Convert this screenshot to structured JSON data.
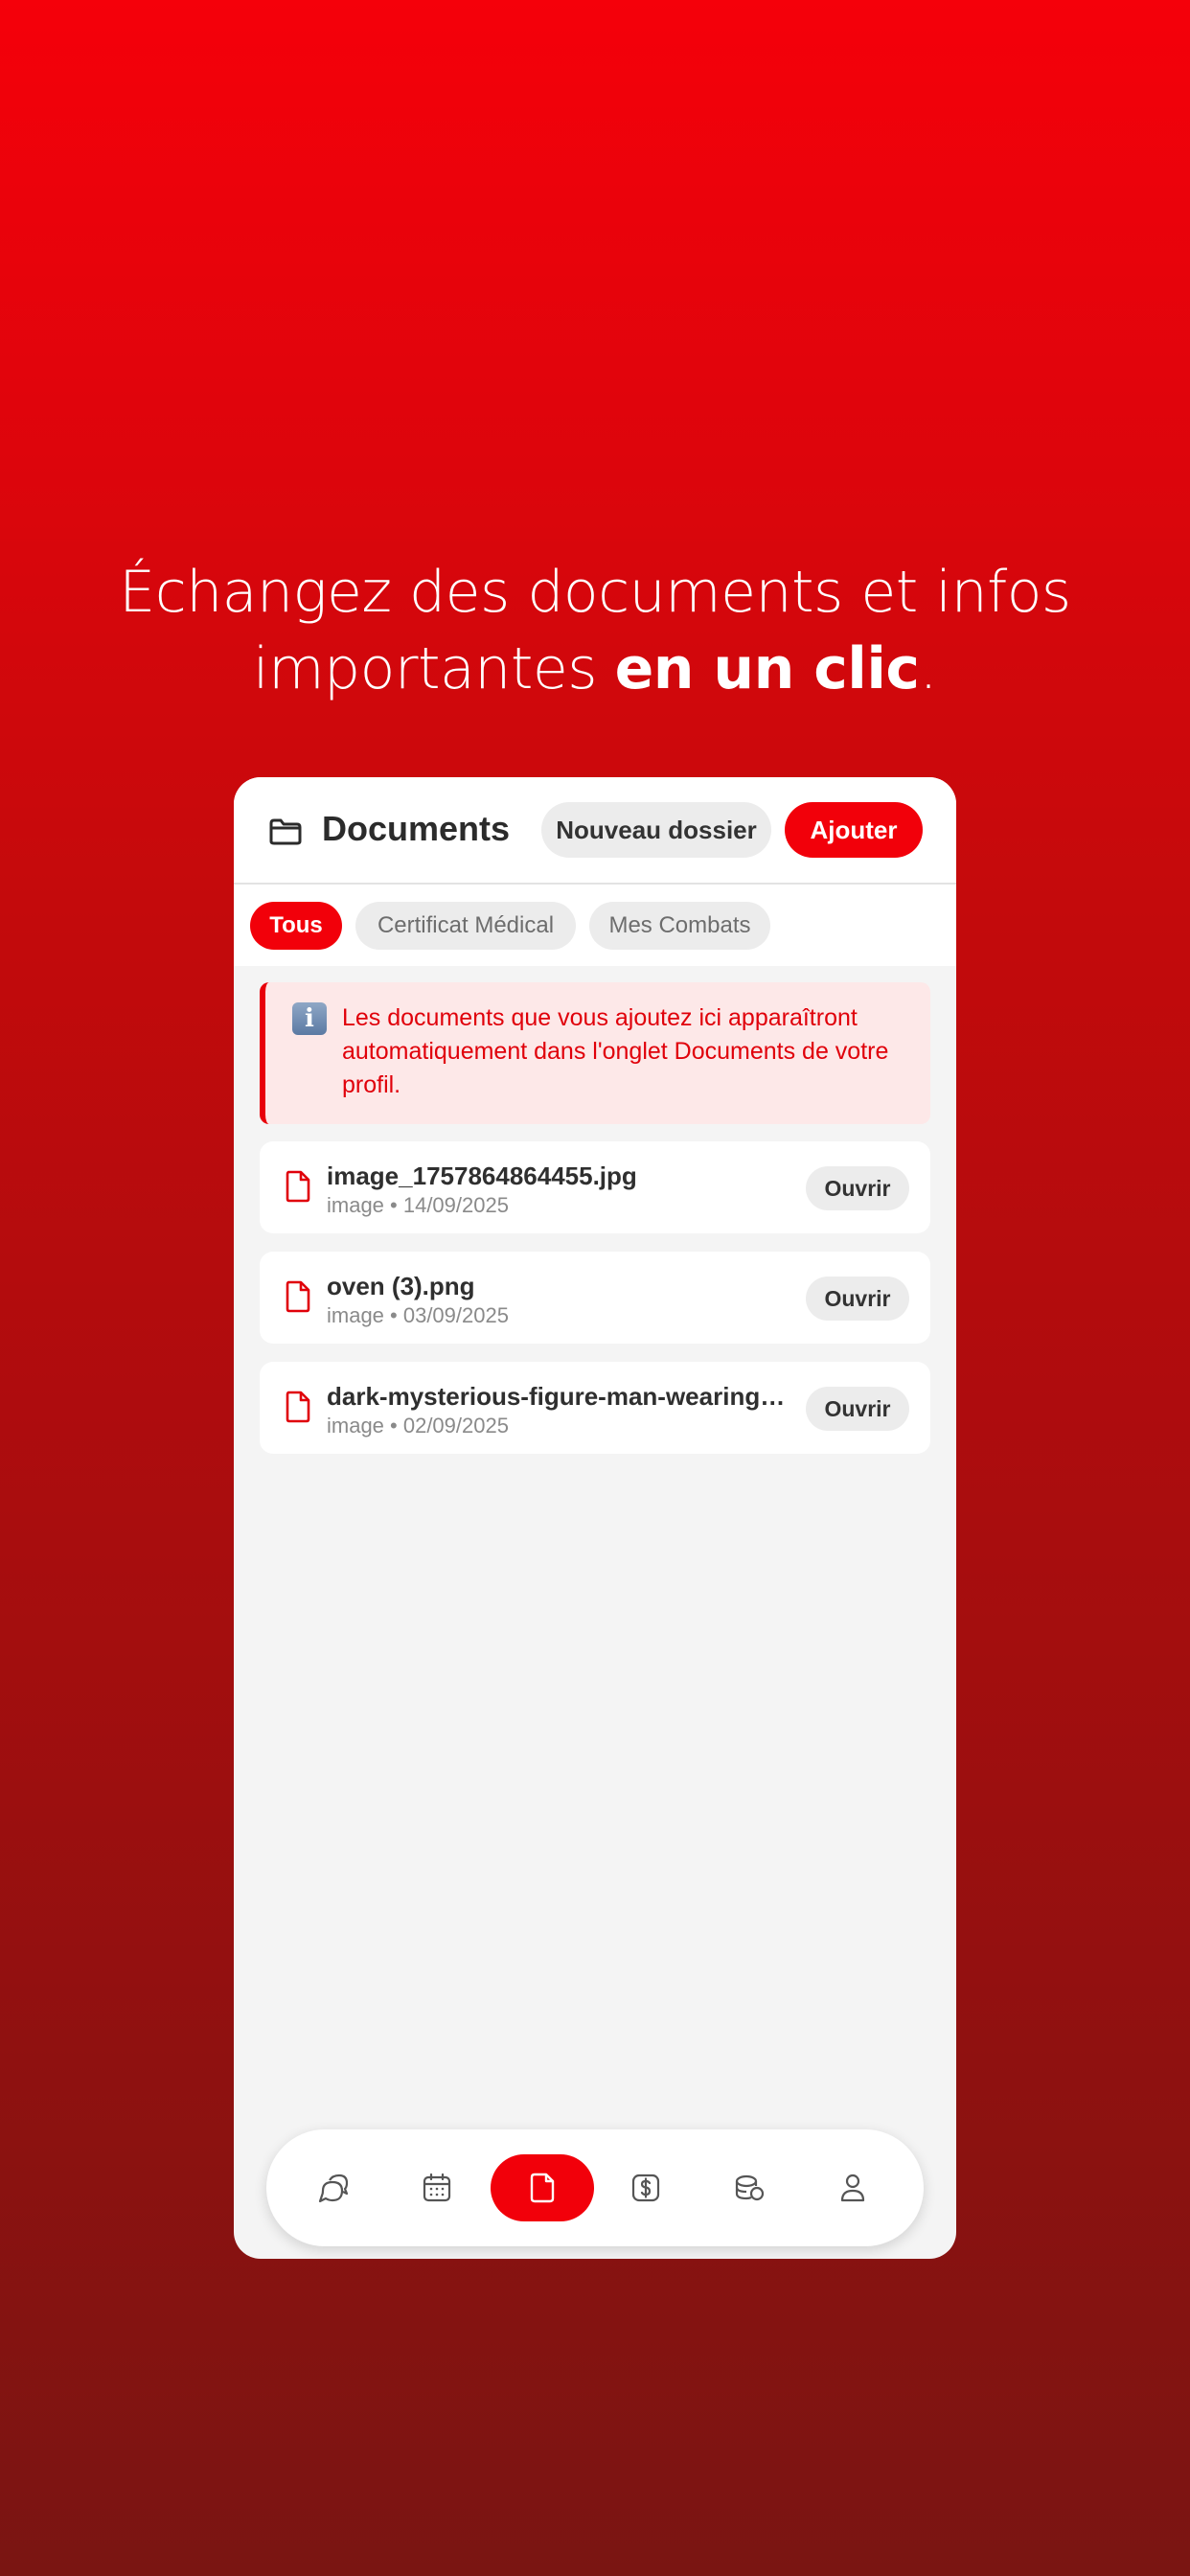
{
  "headline": {
    "line1": "Échangez des documents et infos",
    "line2_prefix": "importantes ",
    "line2_bold": "en un clic",
    "line2_suffix": "."
  },
  "header": {
    "title": "Documents",
    "new_folder_label": "Nouveau dossier",
    "add_label": "Ajouter"
  },
  "filters": [
    {
      "label": "Tous",
      "active": true
    },
    {
      "label": "Certificat Médical",
      "active": false
    },
    {
      "label": "Mes Combats",
      "active": false
    }
  ],
  "info": {
    "icon": "info-icon",
    "glyph": "i",
    "text": "Les documents que vous ajoutez ici apparaîtront automatiquement dans l'onglet Documents de votre profil."
  },
  "files": [
    {
      "name": "image_1757864864455.jpg",
      "meta": "image • 14/09/2025",
      "open_label": "Ouvrir"
    },
    {
      "name": "oven (3).png",
      "meta": "image • 03/09/2025",
      "open_label": "Ouvrir"
    },
    {
      "name": "dark-mysterious-figure-man-wearing-...",
      "meta": "image • 02/09/2025",
      "open_label": "Ouvrir"
    }
  ],
  "tabbar": {
    "items": [
      {
        "icon": "chat-icon",
        "active": false
      },
      {
        "icon": "calendar-icon",
        "active": false
      },
      {
        "icon": "document-icon",
        "active": true
      },
      {
        "icon": "dollar-icon",
        "active": false
      },
      {
        "icon": "coins-icon",
        "active": false
      },
      {
        "icon": "user-icon",
        "active": false
      }
    ]
  },
  "colors": {
    "accent": "#f2000a",
    "info_bg": "#fde8e8",
    "text_dark": "#2b2b2b"
  }
}
